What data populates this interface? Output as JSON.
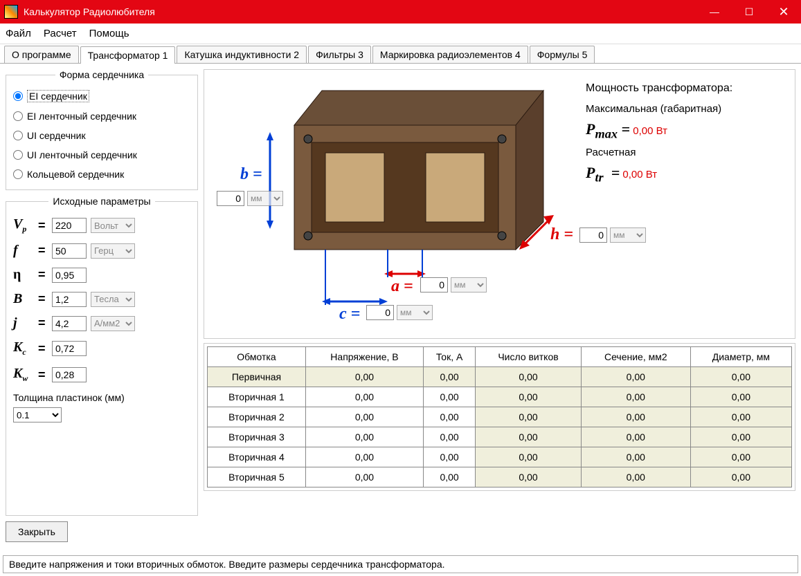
{
  "window": {
    "title": "Калькулятор Радиолюбителя"
  },
  "menu": {
    "file": "Файл",
    "calc": "Расчет",
    "help": "Помощь"
  },
  "tabs": [
    {
      "label": "О программе"
    },
    {
      "label": "Трансформатор 1"
    },
    {
      "label": "Катушка индуктивности 2"
    },
    {
      "label": "Фильтры 3"
    },
    {
      "label": "Маркировка радиоэлементов 4"
    },
    {
      "label": "Формулы 5"
    }
  ],
  "core_shape": {
    "legend": "Форма сердечника",
    "options": [
      "EI сердечник",
      "EI ленточный сердечник",
      "UI сердечник",
      "UI ленточный сердечник",
      "Кольцевой сердечник"
    ]
  },
  "params": {
    "legend": "Исходные параметры",
    "vp": {
      "sym": "V",
      "sub": "p",
      "value": "220",
      "unit": "Вольт"
    },
    "f": {
      "sym": "f",
      "value": "50",
      "unit": "Герц"
    },
    "eta": {
      "sym": "η",
      "value": "0,95"
    },
    "B": {
      "sym": "B",
      "value": "1,2",
      "unit": "Тесла"
    },
    "j": {
      "sym": "j",
      "value": "4,2",
      "unit": "А/мм2"
    },
    "Kc": {
      "sym": "K",
      "sub": "c",
      "value": "0,72"
    },
    "Kw": {
      "sym": "K",
      "sub": "w",
      "value": "0,28"
    },
    "thickness_label": "Толщина пластинок (мм)",
    "thickness_value": "0.1"
  },
  "dims": {
    "b": {
      "label": "b =",
      "value": "0",
      "unit": "мм"
    },
    "a": {
      "label": "a =",
      "value": "0",
      "unit": "мм"
    },
    "c": {
      "label": "c =",
      "value": "0",
      "unit": "мм"
    },
    "h": {
      "label": "h =",
      "value": "0",
      "unit": "мм"
    }
  },
  "power": {
    "header": "Мощность трансформатора:",
    "max_label": "Максимальная (габаритная)",
    "max_sym": "Pmax",
    "max_value": "0,00 Вт",
    "calc_label": "Расчетная",
    "calc_sym": "Ptr",
    "calc_value": "0,00 Вт"
  },
  "table": {
    "headers": [
      "Обмотка",
      "Напряжение, В",
      "Ток, А",
      "Число витков",
      "Сечение, мм2",
      "Диаметр, мм"
    ],
    "rows": [
      {
        "name": "Первичная",
        "v": "0,00",
        "i": "0,00",
        "n": "0,00",
        "s": "0,00",
        "d": "0,00",
        "primary": true
      },
      {
        "name": "Вторичная 1",
        "v": "0,00",
        "i": "0,00",
        "n": "0,00",
        "s": "0,00",
        "d": "0,00"
      },
      {
        "name": "Вторичная 2",
        "v": "0,00",
        "i": "0,00",
        "n": "0,00",
        "s": "0,00",
        "d": "0,00"
      },
      {
        "name": "Вторичная 3",
        "v": "0,00",
        "i": "0,00",
        "n": "0,00",
        "s": "0,00",
        "d": "0,00"
      },
      {
        "name": "Вторичная 4",
        "v": "0,00",
        "i": "0,00",
        "n": "0,00",
        "s": "0,00",
        "d": "0,00"
      },
      {
        "name": "Вторичная 5",
        "v": "0,00",
        "i": "0,00",
        "n": "0,00",
        "s": "0,00",
        "d": "0,00"
      }
    ]
  },
  "close_button": "Закрыть",
  "status": "Введите напряжения и токи вторичных обмоток. Введите размеры сердечника трансформатора.",
  "unit_mm": "мм"
}
